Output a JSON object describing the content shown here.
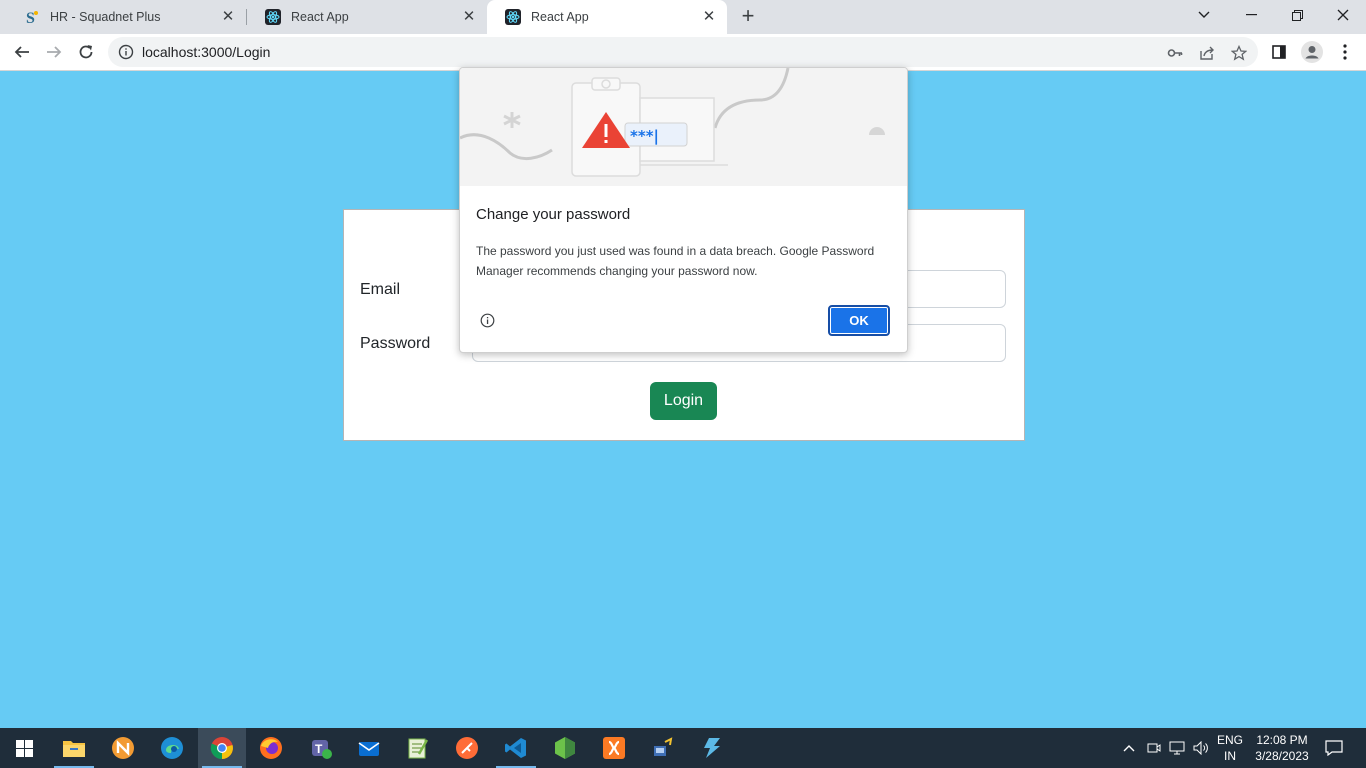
{
  "browser": {
    "tabs": [
      {
        "title": "HR - Squadnet Plus",
        "favicon": "squadnet-s-icon",
        "active": false
      },
      {
        "title": "React App",
        "favicon": "react-icon",
        "active": false
      },
      {
        "title": "React App",
        "favicon": "react-icon",
        "active": true
      }
    ],
    "url": "localhost:3000/Login"
  },
  "login_form": {
    "email_label": "Email",
    "password_label": "Password",
    "email_value": "",
    "password_value": "",
    "login_button": "Login"
  },
  "password_dialog": {
    "title": "Change your password",
    "body": "The password you just used was found in a data breach. Google Password Manager recommends changing your password now.",
    "ok_button": "OK",
    "illustration_text": "***|"
  },
  "taskbar": {
    "apps": [
      "start",
      "file-explorer",
      "n-app",
      "edge",
      "chrome",
      "firefox",
      "teams",
      "mail",
      "notepad-plus",
      "postman",
      "vscode",
      "node",
      "xampp",
      "network-tool",
      "bolt-app"
    ],
    "language": "ENG",
    "region": "IN",
    "time": "12:08 PM",
    "date": "3/28/2023"
  },
  "colors": {
    "page_background": "#66cbf4",
    "login_button": "#198754",
    "ok_button": "#1a73e8",
    "warning_red": "#ea4335"
  }
}
